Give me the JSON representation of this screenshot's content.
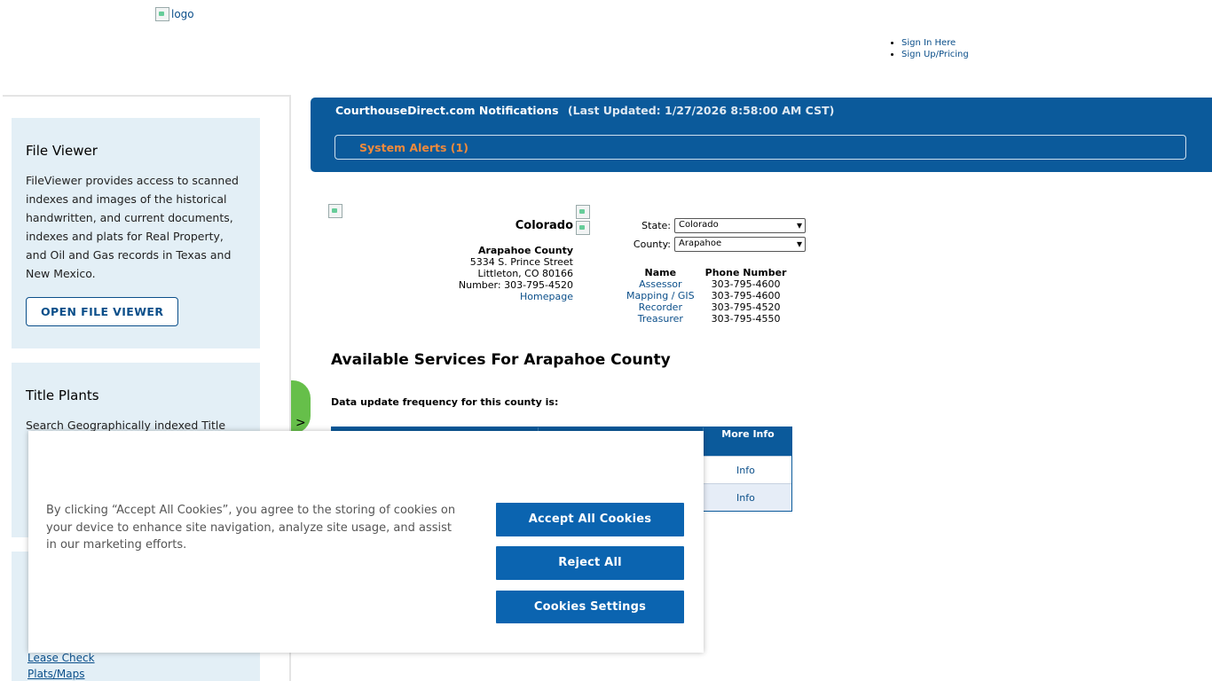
{
  "header": {
    "logo_alt": "logo",
    "links": [
      "Sign In Here",
      "Sign Up/Pricing"
    ]
  },
  "sidebar": {
    "file_viewer": {
      "title": "File Viewer",
      "text": "FileViewer provides access to scanned indexes and images of the historical handwritten, and current documents, indexes and plats for Real Property, and Oil and Gas records in Texas and New Mexico.",
      "button": "OPEN FILE VIEWER"
    },
    "title_plants": {
      "title": "Title Plants",
      "text": "Search Geographically indexed Title"
    },
    "links": [
      "Lease Check",
      "Plats/Maps"
    ],
    "toggle_glyph": ">"
  },
  "notifications": {
    "title": "CourthouseDirect.com Notifications",
    "updated": "(Last Updated: 1/27/2026 8:58:00 AM CST)",
    "alerts_label": "System Alerts (1)"
  },
  "county": {
    "state": "Colorado",
    "name": "Arapahoe County",
    "address1": "5334 S. Prince Street",
    "address2": "Littleton, CO 80166",
    "number": "Number: 303-795-4520",
    "homepage": "Homepage"
  },
  "selectors": {
    "state_label": "State:",
    "state_value": "Colorado",
    "county_label": "County:",
    "county_value": "Arapahoe"
  },
  "contacts": {
    "headers": [
      "Name",
      "Phone Number"
    ],
    "rows": [
      {
        "name": "Assessor",
        "phone": "303-795-4600"
      },
      {
        "name": "Mapping / GIS",
        "phone": "303-795-4600"
      },
      {
        "name": "Recorder",
        "phone": "303-795-4520"
      },
      {
        "name": "Treasurer",
        "phone": "303-795-4550"
      }
    ]
  },
  "services": {
    "title": "Available Services For Arapahoe County",
    "update_frequency": "Data update frequency for this county is:",
    "more_info_header": "More Info",
    "rows": [
      {
        "link": "Info"
      },
      {
        "link": "Info"
      }
    ]
  },
  "cookie": {
    "text": "By clicking “Accept All Cookies”, you agree to the storing of cookies on your device to enhance site navigation, analyze site usage, and assist in our marketing efforts.",
    "accept": "Accept All Cookies",
    "reject": "Reject All",
    "settings": "Cookies Settings"
  }
}
